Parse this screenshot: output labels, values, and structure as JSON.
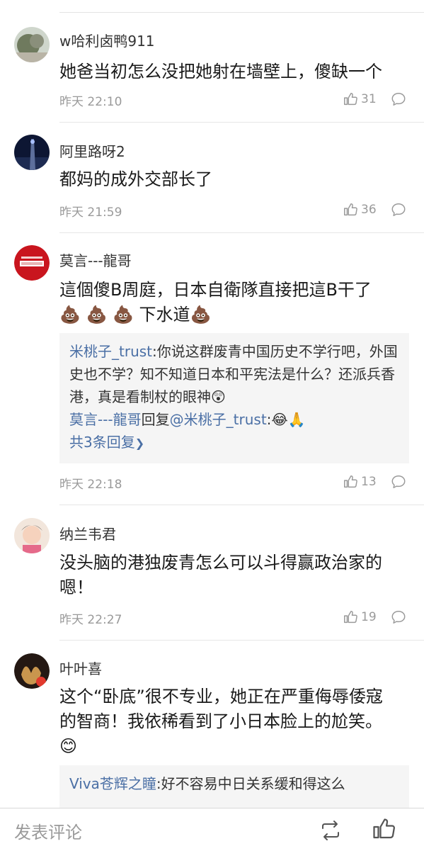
{
  "comments": [
    {
      "username": "w哈利卤鸭911",
      "text": "她爸当初怎么没把她射在墙壁上，傻缺一个",
      "time": "昨天 22:10",
      "likes": "31"
    },
    {
      "username": "阿里路呀2",
      "text": "都妈的成外交部长了",
      "time": "昨天 21:59",
      "likes": "36"
    },
    {
      "username": "莫言---龍哥",
      "text_line1": "這個傻B周庭，日本自衛隊直接把這B干了",
      "text_line2_emoji": "💩 💩 💩",
      "text_line2_word": "下水道",
      "text_line2_emoji_end": "💩",
      "reply_box": {
        "reply1_user": "米桃子_trust",
        "reply1_text": ":你说这群废青中国历史不学行吧，外国史也不学？知不知道日本和平宪法是什么？还派兵香港，真是看制杖的眼神",
        "reply1_emoji": "😲",
        "reply2_user": "莫言---龍哥",
        "reply2_mid": "回复",
        "reply2_target": "@米桃子_trust",
        "reply2_text": ":😂🙏",
        "more_replies": "共3条回复"
      },
      "time": "昨天 22:18",
      "likes": "13"
    },
    {
      "username": "纳兰韦君",
      "text_line1": "没头脑的港独废青怎么可以斗得赢政治家的",
      "text_line2": "嗯！",
      "time": "昨天 22:27",
      "likes": "19"
    },
    {
      "username": "叶叶喜",
      "text_line1": "这个“卧底”很不专业，她正在严重侮辱倭寇",
      "text_line2": "的智商！我依稀看到了小日本脸上的尬笑。",
      "text_emoji": "😊",
      "reply_box": {
        "reply1_user": "Viva苍辉之瞳",
        "reply1_text": ":好不容易中日关系缓和得这么"
      }
    }
  ],
  "bottom_bar": {
    "comment_prompt": "发表评论"
  },
  "colors": {
    "link": "#4a6fa5",
    "meta": "#9a9a9a",
    "reply_bg": "#f5f5f5"
  }
}
